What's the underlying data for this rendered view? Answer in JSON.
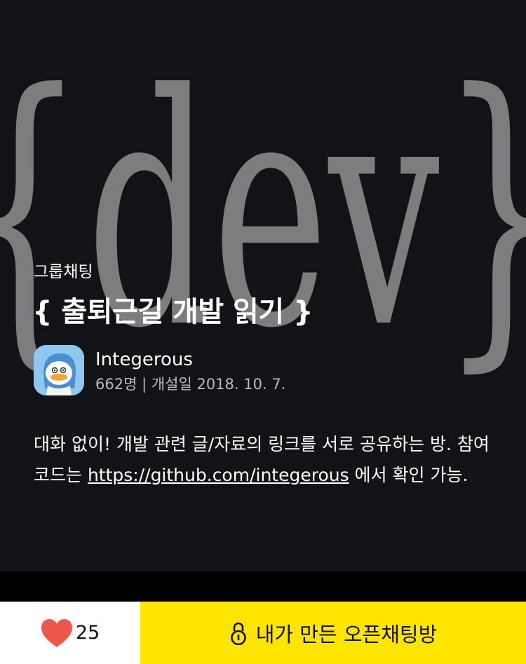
{
  "room": {
    "background_text": "{dev}",
    "category": "그룹채팅",
    "title": "{ 출퇴근길 개발 읽기 }",
    "owner": "Integerous",
    "meta": "662명 | 개설일 2018. 10. 7.",
    "description_before": "대화 없이! 개발 관련 글/자료의 링크를 서로 공유하는 방. 참여코드는 ",
    "description_link": "https://github.com/integerous",
    "description_after": " 에서 확인 가능."
  },
  "footer": {
    "like_count": "25",
    "join_label": "내가 만든 오픈채팅방"
  },
  "colors": {
    "hero_background": "#121316",
    "join_button": "#fee500",
    "heart": "#f0574c"
  },
  "icons": [
    "heart-icon",
    "lock-icon",
    "avatar"
  ]
}
